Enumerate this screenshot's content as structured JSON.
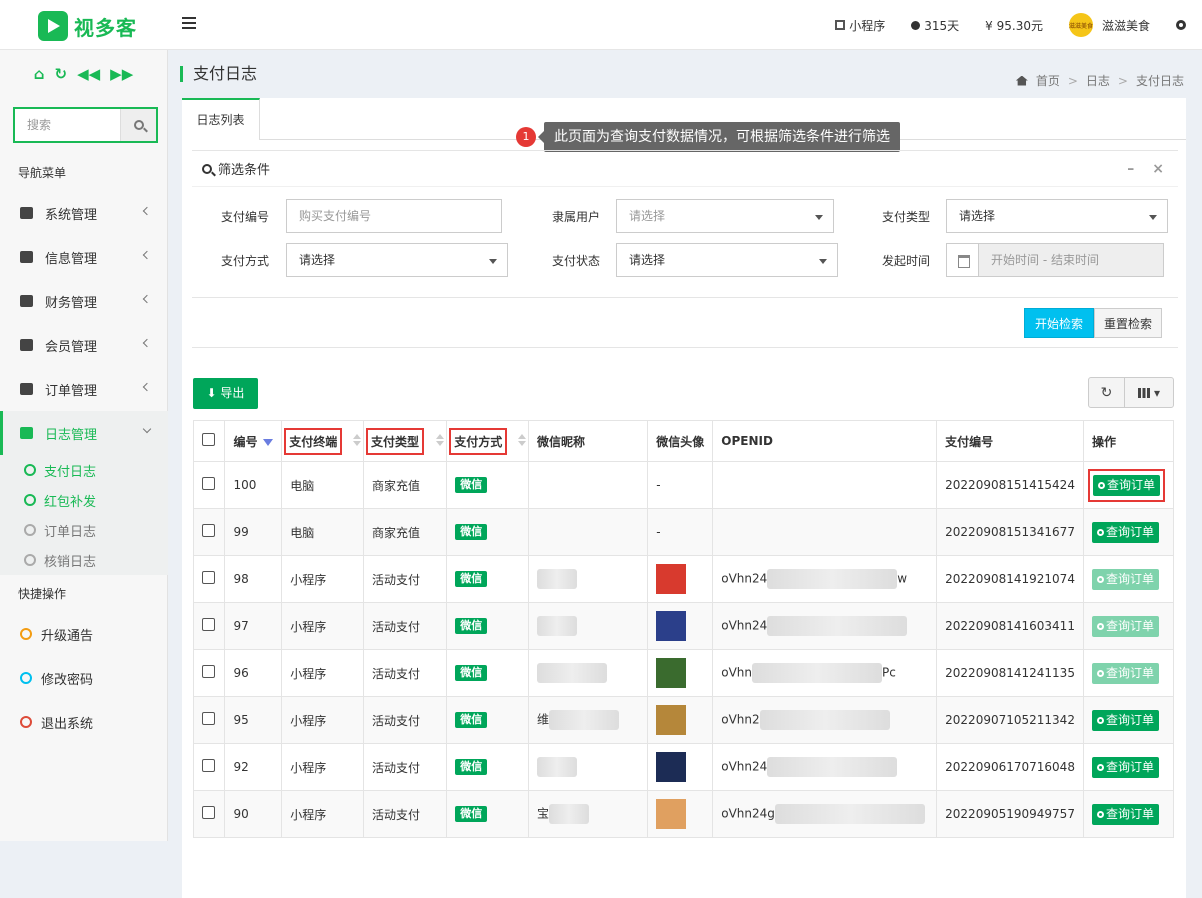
{
  "header": {
    "logo_text": "视多客",
    "mini_program": "小程序",
    "days": "315天",
    "balance": "¥ 95.30元",
    "user_name": "滋滋美食",
    "avatar_text": "滋滋美食"
  },
  "sidebar": {
    "search_placeholder": "搜索",
    "nav_title": "导航菜单",
    "menu": [
      {
        "label": "系统管理"
      },
      {
        "label": "信息管理"
      },
      {
        "label": "财务管理"
      },
      {
        "label": "会员管理"
      },
      {
        "label": "订单管理"
      },
      {
        "label": "日志管理"
      }
    ],
    "sub_menu": [
      {
        "label": "支付日志"
      },
      {
        "label": "红包补发"
      },
      {
        "label": "订单日志"
      },
      {
        "label": "核销日志"
      }
    ],
    "quick_title": "快捷操作",
    "quick": [
      {
        "label": "升级通告",
        "color": "#f39c12"
      },
      {
        "label": "修改密码",
        "color": "#00c0ef"
      },
      {
        "label": "退出系统",
        "color": "#dd4b39"
      }
    ]
  },
  "page": {
    "title": "支付日志",
    "breadcrumb": [
      "首页",
      "日志",
      "支付日志"
    ],
    "tab": "日志列表",
    "tip_number": "1",
    "tip_text": "此页面为查询支付数据情况，可根据筛选条件进行筛选"
  },
  "filter": {
    "title": "筛选条件",
    "minimize": "–",
    "close": "×",
    "pay_no_label": "支付编号",
    "pay_no_placeholder": "购买支付编号",
    "user_label": "隶属用户",
    "user_value": "请选择",
    "type_label": "支付类型",
    "type_value": "请选择",
    "method_label": "支付方式",
    "method_value": "请选择",
    "status_label": "支付状态",
    "status_value": "请选择",
    "time_label": "发起时间",
    "time_placeholder": "开始时间 - 结束时间",
    "search_button": "开始检索",
    "reset_button": "重置检索"
  },
  "toolbar": {
    "export": "导出",
    "refresh": "↻"
  },
  "table": {
    "headers": {
      "id": "编号",
      "terminal": "支付终端",
      "type": "支付类型",
      "method": "支付方式",
      "nickname": "微信昵称",
      "avatar": "微信头像",
      "openid": "OPENID",
      "pay_no": "支付编号",
      "action": "操作"
    },
    "rows": [
      {
        "id": "100",
        "terminal": "电脑",
        "type": "商家充值",
        "method": "微信",
        "nickname": "",
        "avatar": "-",
        "openid": "",
        "pay_no": "20220908151415424",
        "action": "查询订单"
      },
      {
        "id": "99",
        "terminal": "电脑",
        "type": "商家充值",
        "method": "微信",
        "nickname": "",
        "avatar": "-",
        "openid": "",
        "pay_no": "20220908151341677",
        "action": "查询订单"
      },
      {
        "id": "98",
        "terminal": "小程序",
        "type": "活动支付",
        "method": "微信",
        "nickname": "",
        "avatar": "",
        "openid": "oVhn24",
        "openid_end": "w",
        "pay_no": "20220908141921074",
        "action": "查询订单"
      },
      {
        "id": "97",
        "terminal": "小程序",
        "type": "活动支付",
        "method": "微信",
        "nickname": "",
        "avatar": "",
        "openid": "oVhn24",
        "openid_end": "",
        "pay_no": "20220908141603411",
        "action": "查询订单"
      },
      {
        "id": "96",
        "terminal": "小程序",
        "type": "活动支付",
        "method": "微信",
        "nickname": "",
        "avatar": "",
        "openid": "oVhn",
        "openid_end": "Pc",
        "pay_no": "20220908141241135",
        "action": "查询订单"
      },
      {
        "id": "95",
        "terminal": "小程序",
        "type": "活动支付",
        "method": "微信",
        "nickname": "维",
        "avatar": "",
        "openid": "oVhn2",
        "openid_end": "",
        "pay_no": "20220907105211342",
        "action": "查询订单"
      },
      {
        "id": "92",
        "terminal": "小程序",
        "type": "活动支付",
        "method": "微信",
        "nickname": "",
        "avatar": "",
        "openid": "oVhn24",
        "openid_end": "",
        "pay_no": "20220906170716048",
        "action": "查询订单"
      },
      {
        "id": "90",
        "terminal": "小程序",
        "type": "活动支付",
        "method": "微信",
        "nickname": "宝",
        "avatar": "",
        "openid": "oVhn24g",
        "openid_end": "",
        "pay_no": "20220905190949757",
        "action": "查询订单"
      }
    ]
  },
  "colors": {
    "brand": "#19b955",
    "success": "#00a65a",
    "info": "#00c0ef",
    "highlight": "#e53935"
  }
}
